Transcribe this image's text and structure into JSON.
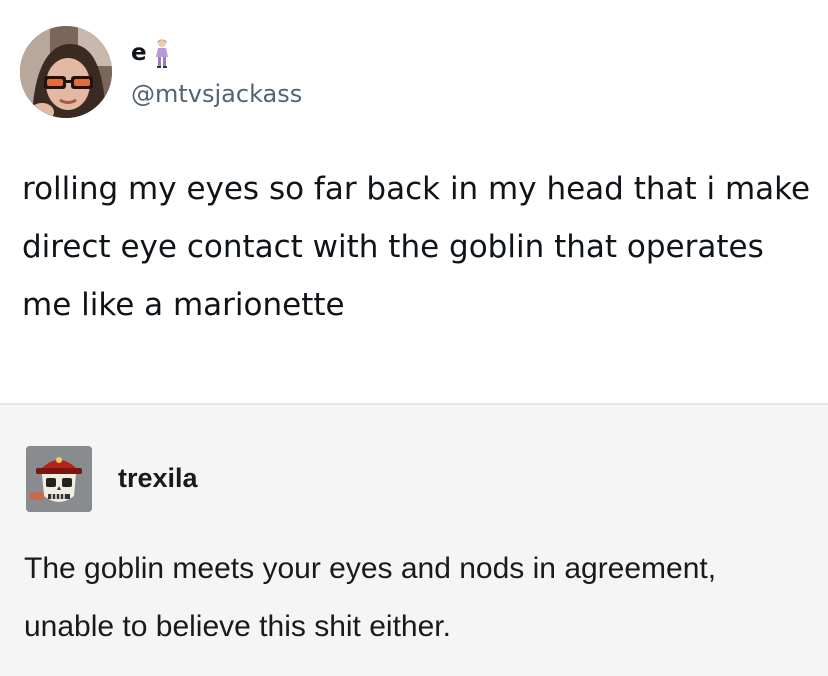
{
  "tweet": {
    "display_name": "e",
    "name_emoji_icon": "woman-standing-emoji-icon",
    "handle": "@mtvsjackass",
    "text": "rolling my eyes so far back in my head that i make direct eye contact with the goblin that operates me like a marionette"
  },
  "reply": {
    "username": "trexila",
    "text": "The goblin meets your eyes and nods in agreement, unable to believe this shit either."
  },
  "colors": {
    "tweet_background": "#ffffff",
    "reply_background": "#f5f5f5",
    "handle_gray": "#536471",
    "divider": "#e6e6e6"
  }
}
